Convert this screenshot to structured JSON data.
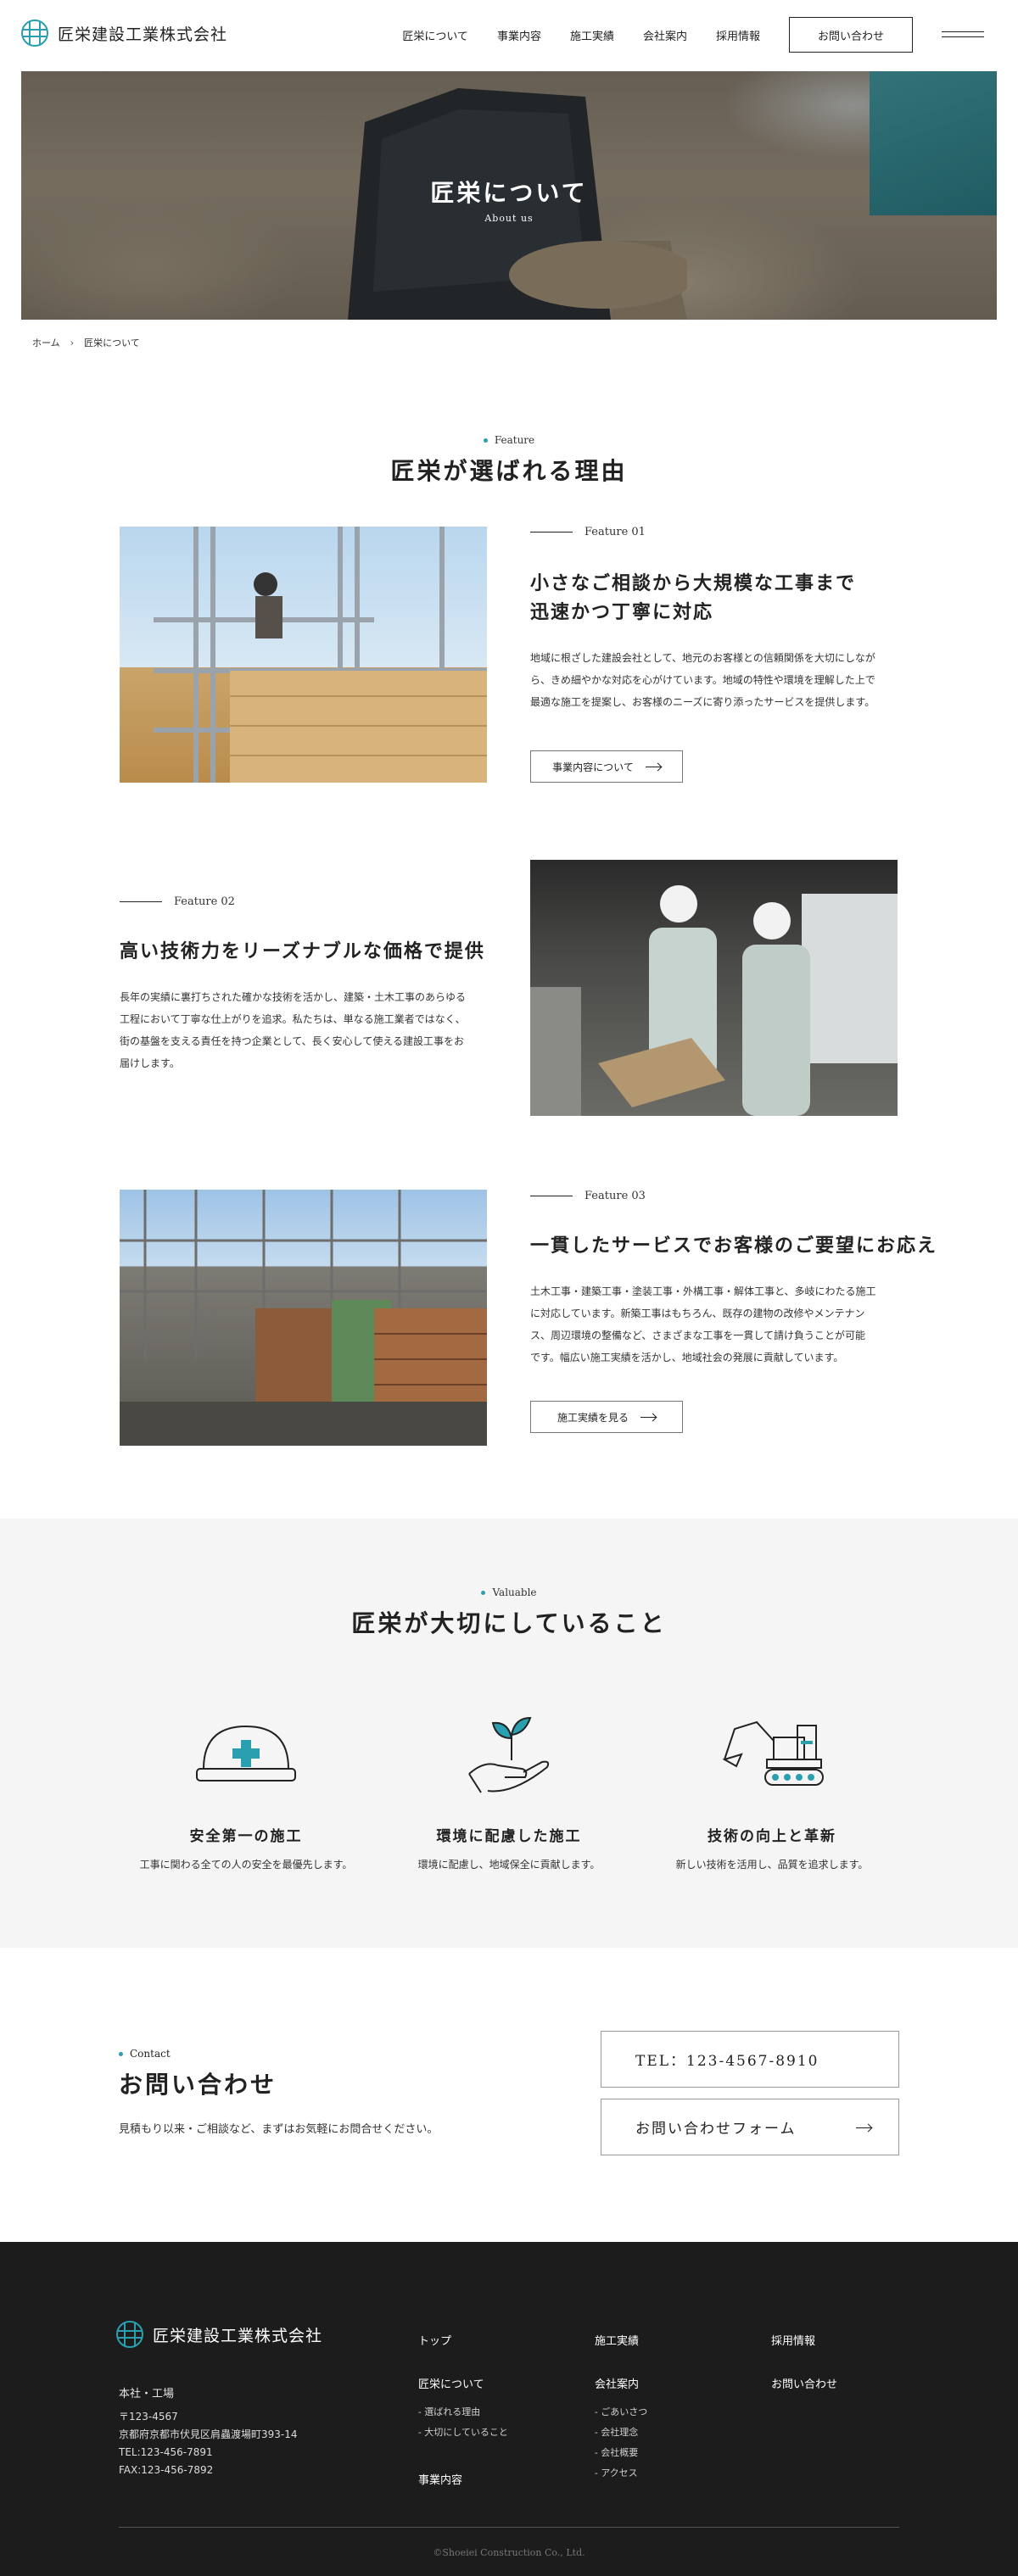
{
  "header": {
    "company_name": "匠栄建設工業株式会社",
    "nav": [
      "匠栄について",
      "事業内容",
      "施工実績",
      "会社案内",
      "採用情報"
    ],
    "contact_button": "お問い合わせ"
  },
  "hero": {
    "title": "匠栄について",
    "subtitle": "About us"
  },
  "breadcrumb": {
    "home": "ホーム",
    "separator": "›",
    "current": "匠栄について"
  },
  "features": {
    "label": "Feature",
    "title": "匠栄が選ばれる理由",
    "items": [
      {
        "number": "Feature 01",
        "title_line1": "小さなご相談から大規模な工事まで",
        "title_line2": "迅速かつ丁寧に対応",
        "body_line1": "地域に根ざした建設会社として、地元のお客様との信頼関係を大切にしなが",
        "body_line2": "ら、きめ細やかな対応を心がけています。地域の特性や環境を理解した上で",
        "body_line3": "最適な施工を提案し、お客様のニーズに寄り添ったサービスを提供します。",
        "button": "事業内容について"
      },
      {
        "number": "Feature 02",
        "title_line1": "高い技術力をリーズナブルな価格で提供",
        "body_line1": "長年の実績に裏打ちされた確かな技術を活かし、建築・土木工事のあらゆる",
        "body_line2": "工程において丁寧な仕上がりを追求。私たちは、単なる施工業者ではなく、",
        "body_line3": "街の基盤を支える責任を持つ企業として、長く安心して使える建設工事をお",
        "body_line4": "届けします。"
      },
      {
        "number": "Feature 03",
        "title_line1": "一貫したサービスでお客様のご要望にお応え",
        "body_line1": "土木工事・建築工事・塗装工事・外構工事・解体工事と、多岐にわたる施工",
        "body_line2": "に対応しています。新築工事はもちろん、既存の建物の改修やメンテナン",
        "body_line3": "ス、周辺環境の整備など、さまざまな工事を一貫して請け負うことが可能",
        "body_line4": "です。幅広い施工実績を活かし、地域社会の発展に貢献しています。",
        "button": "施工実績を見る"
      }
    ]
  },
  "valuable": {
    "label": "Valuable",
    "title": "匠栄が大切にしていること",
    "items": [
      {
        "icon": "helmet-icon",
        "title": "安全第一の施工",
        "desc": "工事に関わる全ての人の安全を最優先します。"
      },
      {
        "icon": "sprout-hand-icon",
        "title": "環境に配慮した施工",
        "desc": "環境に配慮し、地域保全に貢献します。"
      },
      {
        "icon": "excavator-icon",
        "title": "技術の向上と革新",
        "desc": "新しい技術を活用し、品質を追求します。"
      }
    ]
  },
  "contact": {
    "label": "Contact",
    "title": "お問い合わせ",
    "desc": "見積もり以来・ご相談など、まずはお気軽にお問合せください。",
    "tel": "TEL：123-4567-8910",
    "form": "お問い合わせフォーム"
  },
  "footer": {
    "company_name": "匠栄建設工業株式会社",
    "office_title": "本社・工場",
    "postal": "〒123-4567",
    "address": "京都府京都市伏見区肩蟲渡場町393-14",
    "tel": "TEL:123-456-7891",
    "fax": "FAX:123-456-7892",
    "col1": {
      "top": "トップ",
      "about": "匠栄について",
      "sub1": "- 選ばれる理由",
      "sub2": "- 大切にしていること",
      "business": "事業内容"
    },
    "col2": {
      "works": "施工実績",
      "company": "会社案内",
      "sub1": "- ごあいさつ",
      "sub2": "- 会社理念",
      "sub3": "- 会社概要",
      "sub4": "- アクセス"
    },
    "col3": {
      "recruit": "採用情報",
      "contact": "お問い合わせ"
    },
    "copyright": "©Shoeiei Construction Co., Ltd."
  },
  "colors": {
    "accent": "#2a9fb0",
    "footer_bg": "#1c1c1c",
    "section_bg": "#f5f5f5"
  }
}
